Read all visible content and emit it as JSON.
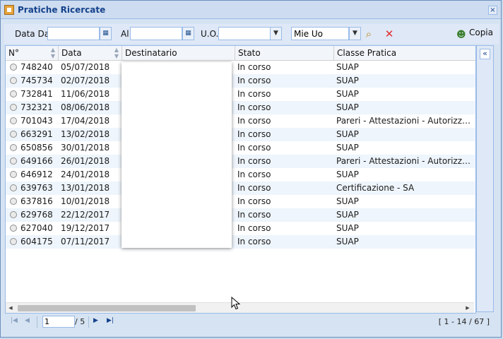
{
  "window": {
    "title": "Pratiche Ricercate",
    "close_glyph": "×"
  },
  "toolbar": {
    "date_from_label": "Data Dal",
    "date_from_value": "",
    "date_to_label": "Al",
    "date_to_value": "",
    "uo_label": "U.O.",
    "uo_value": "",
    "scope_value": "Mie Uo",
    "search_icon": "magnifier-icon",
    "clear_icon": "red-x-icon",
    "copy_label": "Copia"
  },
  "grid": {
    "columns": [
      "N°",
      "Data",
      "Destinatario",
      "Stato",
      "Classe Pratica"
    ],
    "rows": [
      {
        "n": "748240",
        "data": "05/07/2018",
        "stato": "In corso",
        "classe": "SUAP"
      },
      {
        "n": "745734",
        "data": "02/07/2018",
        "stato": "In corso",
        "classe": "SUAP"
      },
      {
        "n": "732841",
        "data": "11/06/2018",
        "stato": "In corso",
        "classe": "SUAP"
      },
      {
        "n": "732321",
        "data": "08/06/2018",
        "stato": "In corso",
        "classe": "SUAP"
      },
      {
        "n": "701043",
        "data": "17/04/2018",
        "stato": "In corso",
        "classe": "Pareri - Attestazioni - Autorizzazio..."
      },
      {
        "n": "663291",
        "data": "13/02/2018",
        "stato": "In corso",
        "classe": "SUAP"
      },
      {
        "n": "650856",
        "data": "30/01/2018",
        "stato": "In corso",
        "classe": "SUAP"
      },
      {
        "n": "649166",
        "data": "26/01/2018",
        "stato": "In corso",
        "classe": "Pareri - Attestazioni - Autorizzazio..."
      },
      {
        "n": "646912",
        "data": "24/01/2018",
        "stato": "In corso",
        "classe": "SUAP"
      },
      {
        "n": "639763",
        "data": "13/01/2018",
        "stato": "In corso",
        "classe": "Certificazione - SA"
      },
      {
        "n": "637816",
        "data": "10/01/2018",
        "stato": "In corso",
        "classe": "SUAP"
      },
      {
        "n": "629768",
        "data": "22/12/2017",
        "stato": "In corso",
        "classe": "SUAP"
      },
      {
        "n": "627040",
        "data": "19/12/2017",
        "stato": "In corso",
        "classe": "SUAP"
      },
      {
        "n": "604175",
        "data": "07/11/2017",
        "stato": "In corso",
        "classe": "SUAP"
      }
    ]
  },
  "sidebar": {
    "expand_glyph": "«"
  },
  "pager": {
    "current_page": "1",
    "of_pages": "/ 5",
    "info": "[ 1 - 14 / 67 ]"
  }
}
